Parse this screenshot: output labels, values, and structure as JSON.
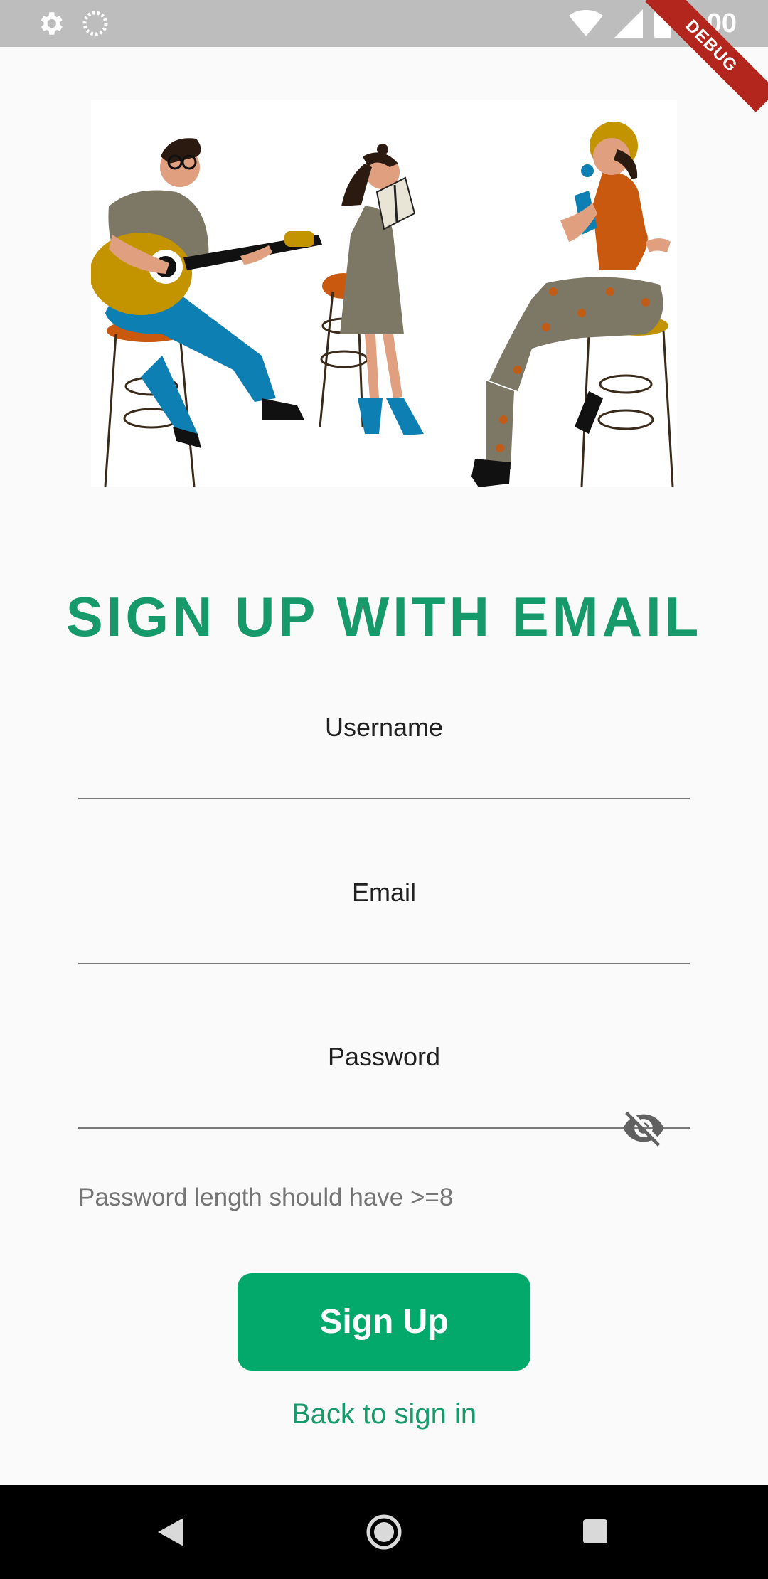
{
  "status_bar": {
    "time": "7:00",
    "debug_label": "DEBUG"
  },
  "title": "SIGN UP WITH EMAIL",
  "form": {
    "username": {
      "label": "Username",
      "value": ""
    },
    "email": {
      "label": "Email",
      "value": ""
    },
    "password": {
      "label": "Password",
      "value": "",
      "helper": "Password length should have >=8"
    }
  },
  "actions": {
    "signup_label": "Sign Up",
    "back_label": "Back to sign in"
  },
  "colors": {
    "accent": "#179a6b",
    "button": "#02a96b"
  },
  "icons": [
    "gear-icon",
    "loading-icon",
    "wifi-icon",
    "signal-icon",
    "battery-icon",
    "eye-off-icon",
    "back-nav-icon",
    "home-nav-icon",
    "recents-nav-icon"
  ]
}
